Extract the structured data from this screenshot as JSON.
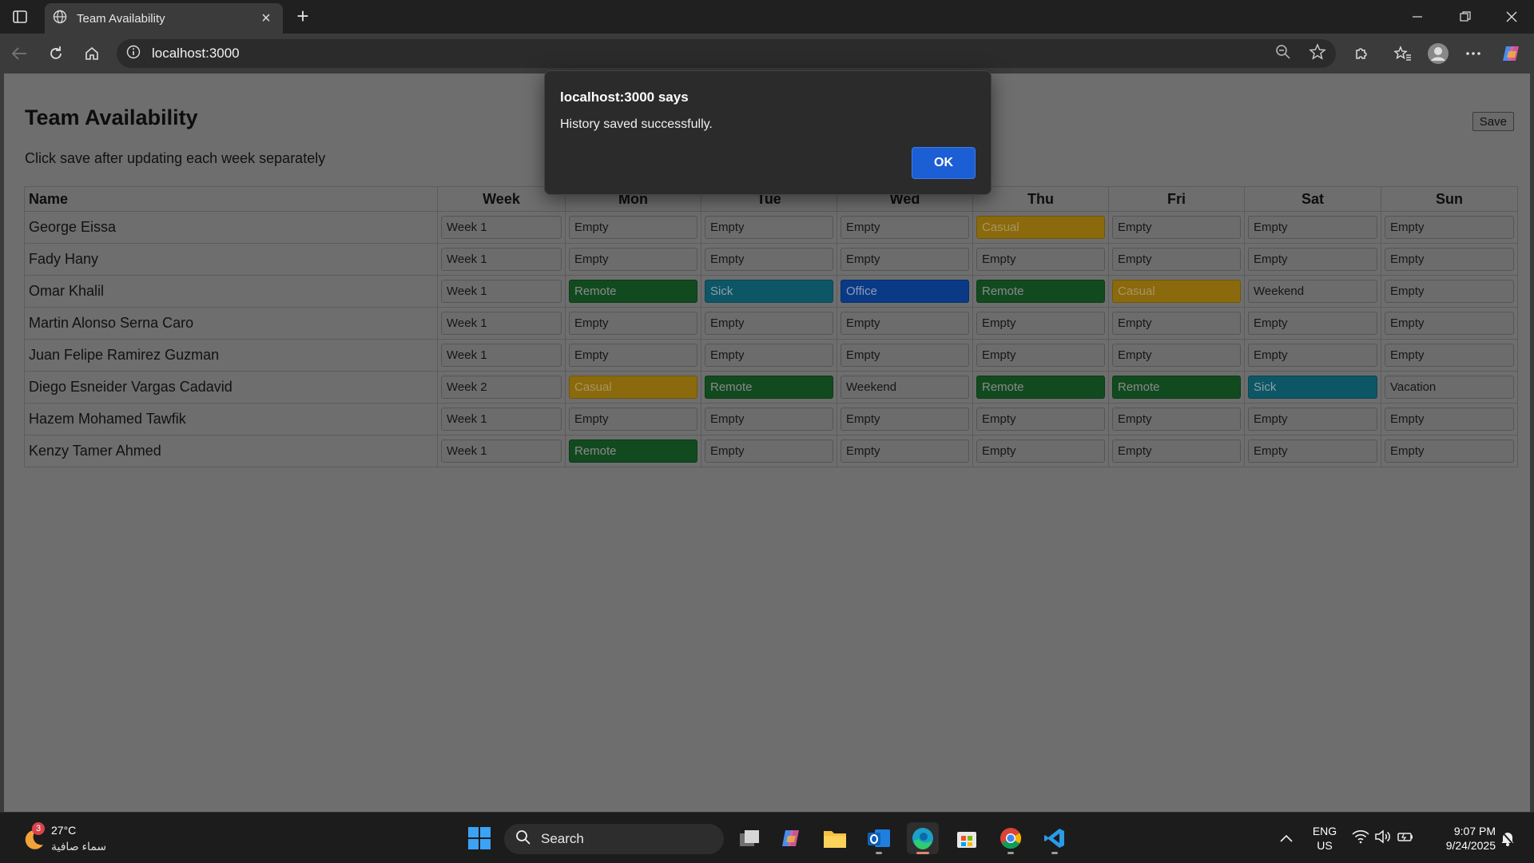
{
  "browser": {
    "tab_title": "Team Availability",
    "url": "localhost:3000"
  },
  "page": {
    "title": "Team Availability",
    "subtitle": "Click save after updating each week separately",
    "save_label": "Save",
    "columns": [
      "Name",
      "Week",
      "Mon",
      "Tue",
      "Wed",
      "Thu",
      "Fri",
      "Sat",
      "Sun"
    ],
    "rows": [
      {
        "name": "George Eissa",
        "week": "Week 1",
        "days": [
          "Empty",
          "Empty",
          "Empty",
          "Casual",
          "Empty",
          "Empty",
          "Empty"
        ]
      },
      {
        "name": "Fady Hany",
        "week": "Week 1",
        "days": [
          "Empty",
          "Empty",
          "Empty",
          "Empty",
          "Empty",
          "Empty",
          "Empty"
        ]
      },
      {
        "name": "Omar Khalil",
        "week": "Week 1",
        "days": [
          "Remote",
          "Sick",
          "Office",
          "Remote",
          "Casual",
          "Weekend",
          "Empty"
        ]
      },
      {
        "name": "Martin Alonso Serna Caro",
        "week": "Week 1",
        "days": [
          "Empty",
          "Empty",
          "Empty",
          "Empty",
          "Empty",
          "Empty",
          "Empty"
        ]
      },
      {
        "name": "Juan Felipe Ramirez Guzman",
        "week": "Week 1",
        "days": [
          "Empty",
          "Empty",
          "Empty",
          "Empty",
          "Empty",
          "Empty",
          "Empty"
        ]
      },
      {
        "name": "Diego Esneider Vargas Cadavid",
        "week": "Week 2",
        "days": [
          "Casual",
          "Remote",
          "Weekend",
          "Remote",
          "Remote",
          "Sick",
          "Vacation"
        ]
      },
      {
        "name": "Hazem Mohamed Tawfik",
        "week": "Week 1",
        "days": [
          "Empty",
          "Empty",
          "Empty",
          "Empty",
          "Empty",
          "Empty",
          "Empty"
        ]
      },
      {
        "name": "Kenzy Tamer Ahmed",
        "week": "Week 1",
        "days": [
          "Remote",
          "Empty",
          "Empty",
          "Empty",
          "Empty",
          "Empty",
          "Empty"
        ]
      }
    ],
    "status_colors": {
      "Remote": "#124a1f",
      "Sick": "#0d5666",
      "Office": "#0a3a86",
      "Casual": "#8a6a0d"
    }
  },
  "alert": {
    "title": "localhost:3000 says",
    "message": "History saved successfully.",
    "ok_label": "OK"
  },
  "taskbar": {
    "weather_badge": "3",
    "temperature": "27°C",
    "condition": "سماء صافية",
    "search_label": "Search",
    "language": "ENG",
    "region": "US",
    "time": "9:07 PM",
    "date": "9/24/2025"
  }
}
